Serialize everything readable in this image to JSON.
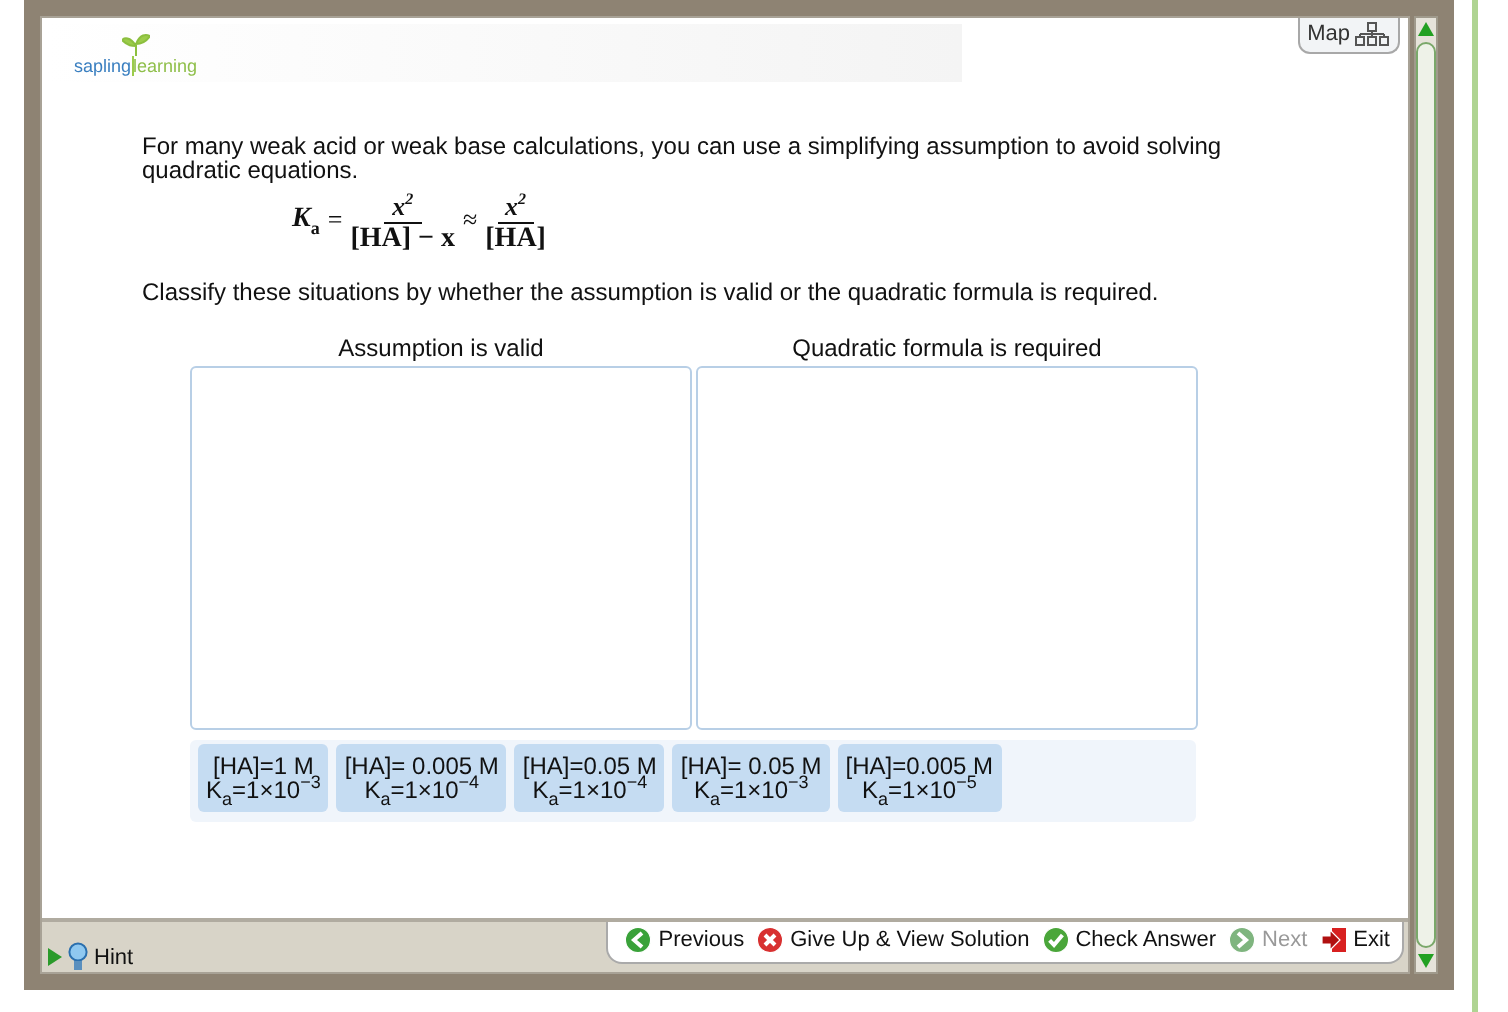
{
  "logo": {
    "text_left": "sapling",
    "text_right": "learning"
  },
  "map_button": {
    "label": "Map"
  },
  "intro": "For many weak acid or weak base calculations, you can use a simplifying assumption to avoid solving quadratic equations.",
  "formula": {
    "lhs": "K",
    "lhs_sub": "a",
    "equals": "=",
    "num1": "x",
    "num1_sup": "2",
    "den1": "[HA] − x",
    "approx": "≈",
    "num2": "x",
    "num2_sup": "2",
    "den2": "[HA]"
  },
  "instruction": "Classify these situations by whether the assumption is valid or the quadratic formula is required.",
  "zones": [
    {
      "heading": "Assumption is valid"
    },
    {
      "heading": "Quadratic formula is required"
    }
  ],
  "tiles": [
    {
      "line1": "[HA]=1 M",
      "line2": "K$_{a}$=1×10$^{−3}$"
    },
    {
      "line1": "[HA]= 0.005 M",
      "line2": "K$_{a}$=1×10$^{−4}$"
    },
    {
      "line1": "[HA]=0.05 M",
      "line2": "K$_{a}$=1×10$^{−4}$"
    },
    {
      "line1": "[HA]= 0.05 M",
      "line2": "K$_{a}$=1×10$^{−3}$"
    },
    {
      "line1": "[HA]=0.005 M",
      "line2": "K$_{a}$=1×10$^{−5}$"
    }
  ],
  "hint": {
    "label": "Hint",
    "expanded": false
  },
  "nav": [
    {
      "kind": "previous",
      "label": "Previous",
      "disabled": false
    },
    {
      "kind": "giveup",
      "label": "Give Up & View Solution",
      "disabled": false
    },
    {
      "kind": "check",
      "label": "Check Answer",
      "disabled": false
    },
    {
      "kind": "next",
      "label": "Next",
      "disabled": true
    },
    {
      "kind": "exit",
      "label": "Exit",
      "disabled": false
    }
  ]
}
